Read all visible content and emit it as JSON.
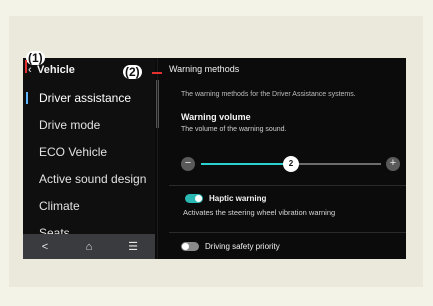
{
  "sidebar": {
    "title": "Vehicle",
    "back_icon": "chevron-left-icon",
    "items": [
      {
        "label": "Driver assistance"
      },
      {
        "label": "Drive mode"
      },
      {
        "label": "ECO Vehicle"
      },
      {
        "label": "Active sound design"
      },
      {
        "label": "Climate"
      },
      {
        "label": "Seats"
      }
    ],
    "nav": {
      "back": "<",
      "home": "⌂",
      "menu": "☰"
    }
  },
  "content": {
    "title": "Warning methods",
    "description": "The warning methods for the Driver Assistance systems.",
    "volume": {
      "label": "Warning volume",
      "sub": "The volume of the warning sound.",
      "value": "2",
      "level_fraction": 0.5,
      "minus": "−",
      "plus": "+"
    },
    "haptic": {
      "label": "Haptic warning",
      "sub": "Activates the steering wheel vibration warning",
      "state": "on"
    },
    "priority": {
      "label": "Driving safety priority",
      "state": "off"
    }
  },
  "callouts": {
    "one": "(1)",
    "two": "(2)"
  },
  "colors": {
    "accent": "#2bd0cf",
    "toggle_on": "#2bb7b2",
    "callout_line": "#e2312f",
    "active_indicator": "#5fb7ff"
  }
}
